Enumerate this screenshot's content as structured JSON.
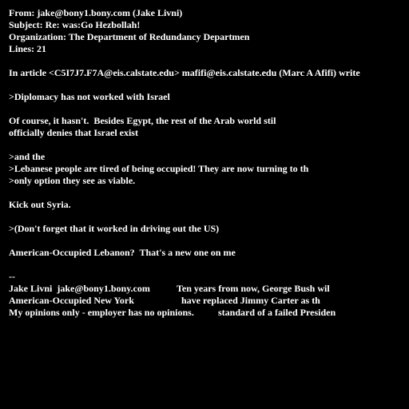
{
  "header": {
    "from": "From: jake@bony1.bony.com (Jake Livni)",
    "subject": "Subject: Re: was:Go Hezbollah!",
    "organization": "Organization: The Department of Redundancy Departmen",
    "lines": "Lines: 21"
  },
  "body": {
    "attribution": "In article <C5I7J7.F7A@eis.calstate.edu> mafifi@eis.calstate.edu (Marc A Afifi) write",
    "quote1": ">Diplomacy has not worked with Israel",
    "reply1_line1": "Of course, it hasn't.  Besides Egypt, the rest of the Arab world stil",
    "reply1_line2": "officially denies that Israel exist",
    "quote2_line1": ">and the",
    "quote2_line2": ">Lebanese people are tired of being occupied! They are now turning to th",
    "quote2_line3": ">only option they see as viable.",
    "reply2": "Kick out Syria.",
    "quote3": ">(Don't forget that it worked in driving out the US)",
    "reply3": "American-Occupied Lebanon?  That's a new one on me"
  },
  "signature": {
    "separator": "--",
    "left": [
      "Jake Livni  jake@bony1.bony.com",
      "American-Occupied New York",
      "My opinions only - employer has no opinions."
    ],
    "right": [
      "Ten years from now, George Bush wil",
      "have replaced Jimmy Carter as th",
      "standard of a failed Presiden"
    ]
  }
}
